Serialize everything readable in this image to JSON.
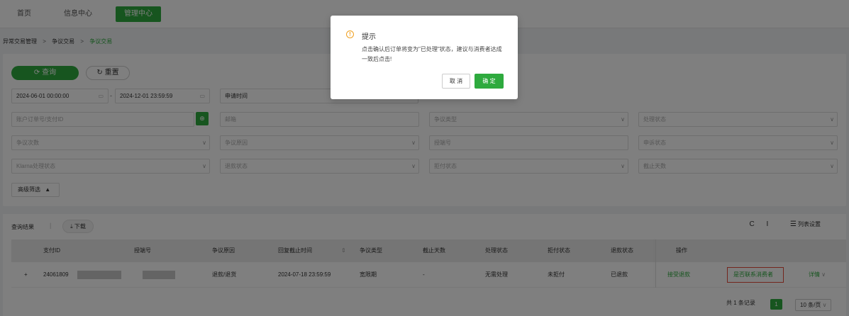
{
  "nav": {
    "home": "首页",
    "info": "信息中心",
    "admin": "管理中心"
  },
  "breadcrumb": {
    "level1": "异常交易管理",
    "level2": "争议交易",
    "level3": "争议交易",
    "sep": ">"
  },
  "filters": {
    "query_btn": "查询",
    "reset_btn": "重置",
    "date_start": "2024-06-01 00:00:00",
    "date_end": "2024-12-01 23:59:59",
    "date_sep": "-",
    "time_type": "申请时间",
    "ph_order": "账户订单号/支付ID",
    "ph_email": "邮箱",
    "ph_dispute_type": "争议类型",
    "ph_process_status": "处理状态",
    "ph_dispute_times": "争议次数",
    "ph_dispute_reason": "争议原因",
    "ph_auth_code": "授端号",
    "ph_appeal_status": "申诉状态",
    "ph_klarna": "Klarna处理状态",
    "ph_refund_status": "退款状态",
    "ph_chargeback": "拒付状态",
    "ph_deadline_days": "截止天数",
    "advanced": "高级筛选",
    "advanced_arrow": "▲"
  },
  "results": {
    "title": "查询结果",
    "sep": "|",
    "download": "下载",
    "column_settings": "列表设置",
    "columns": [
      "支付ID",
      "授端号",
      "争议原因",
      "回复截止时间",
      "争议类型",
      "截止天数",
      "处理状态",
      "拒付状态",
      "退款状态",
      "操作"
    ],
    "rows": [
      {
        "expand": "+",
        "pay_id": "24061809",
        "reason": "退款/退货",
        "reply_deadline": "2024-07-18 23:59:59",
        "dispute_type": "宽限期",
        "deadline_days": "-",
        "process_status": "无需处理",
        "chargeback_status": "未拒付",
        "refund_status": "已退款",
        "op_accept": "接受退款",
        "op_contact": "是否联系消费者",
        "op_detail": "详情"
      }
    ],
    "total": "共 1 条记录",
    "page": "1",
    "page_size": "10 条/页"
  },
  "dialog": {
    "title": "提示",
    "icon": "!",
    "message": "点击确认后订单将变为\"已处理\"状态，建议与消费者达成一致后点击!",
    "cancel": "取 消",
    "ok": "确 定"
  },
  "colors": {
    "accent": "#2eaa3e",
    "warning": "#f0a020",
    "highlight": "#e64a3b"
  }
}
